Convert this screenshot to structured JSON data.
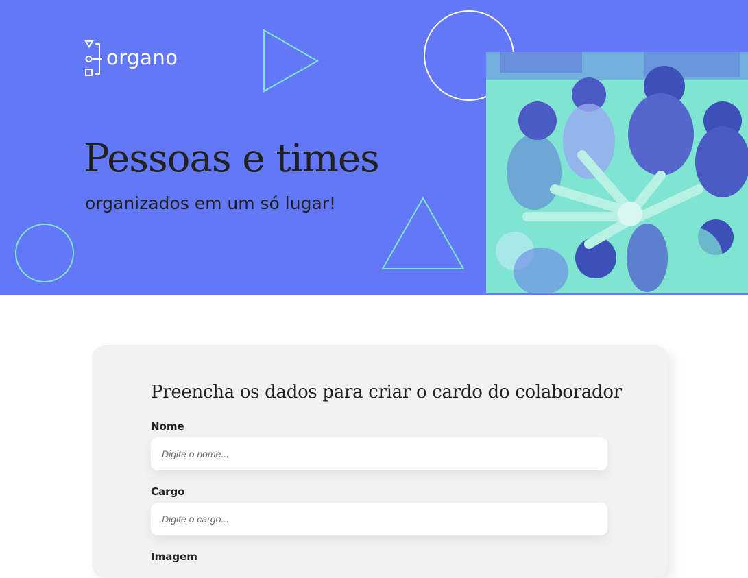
{
  "banner": {
    "logo_text": "organo",
    "title": "Pessoas e times",
    "subtitle": "organizados em um só lugar!",
    "colors": {
      "background": "#6278f7",
      "shape_stroke_mint": "#7fe4d2",
      "shape_stroke_white": "#ffffff",
      "photo_tint": "#7fe4d2"
    },
    "decor_icons": [
      "triangle-play-icon",
      "circle-outline",
      "triangle-outline",
      "circle-outline-small"
    ]
  },
  "form": {
    "title": "Preencha os dados para criar o cardo do colaborador",
    "fields": [
      {
        "label": "Nome",
        "placeholder": "Digite o nome...",
        "value": ""
      },
      {
        "label": "Cargo",
        "placeholder": "Digite o cargo...",
        "value": ""
      },
      {
        "label": "Imagem"
      }
    ]
  }
}
